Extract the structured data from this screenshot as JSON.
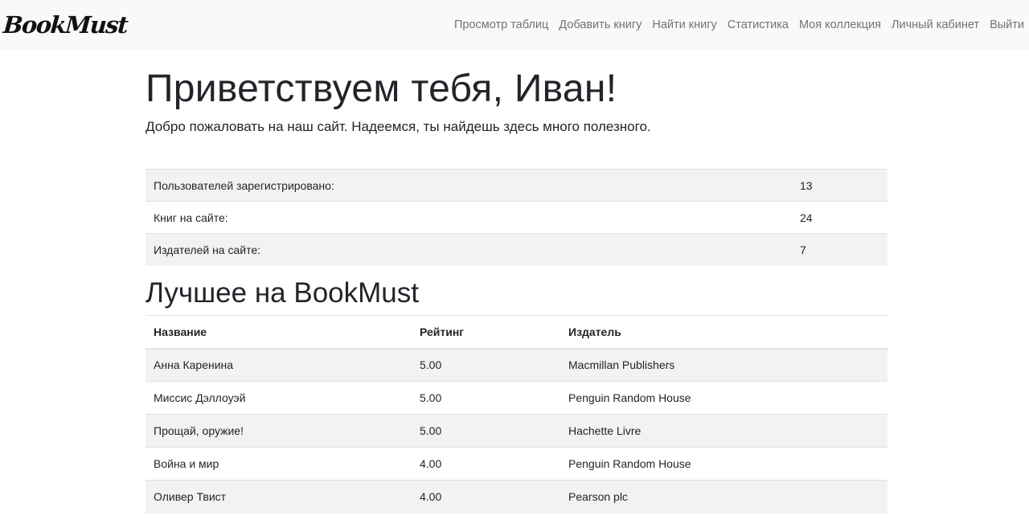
{
  "navbar": {
    "brand": "BookMust",
    "links": [
      {
        "label": "Просмотр таблиц"
      },
      {
        "label": "Добавить книгу"
      },
      {
        "label": "Найти книгу"
      },
      {
        "label": "Статистика"
      },
      {
        "label": "Моя коллекция"
      },
      {
        "label": "Личный кабинет"
      },
      {
        "label": "Выйти"
      }
    ]
  },
  "hero": {
    "title": "Приветствуем тебя, Иван!",
    "lead": "Добро пожаловать на наш сайт. Надеемся, ты найдешь здесь много полезного."
  },
  "stats": [
    {
      "label": "Пользователей зарегистрировано:",
      "value": "13"
    },
    {
      "label": "Книг на сайте:",
      "value": "24"
    },
    {
      "label": "Издателей на сайте:",
      "value": "7"
    }
  ],
  "best": {
    "title": "Лучшее на BookMust",
    "columns": [
      "Название",
      "Рейтинг",
      "Издатель"
    ],
    "rows": [
      [
        "Анна Каренина",
        "5.00",
        "Macmillan Publishers"
      ],
      [
        "Миссис Дэллоуэй",
        "5.00",
        "Penguin Random House"
      ],
      [
        "Прощай, оружие!",
        "5.00",
        "Hachette Livre"
      ],
      [
        "Война и мир",
        "4.00",
        "Penguin Random House"
      ],
      [
        "Оливер Твист",
        "4.00",
        "Pearson plc"
      ]
    ]
  }
}
